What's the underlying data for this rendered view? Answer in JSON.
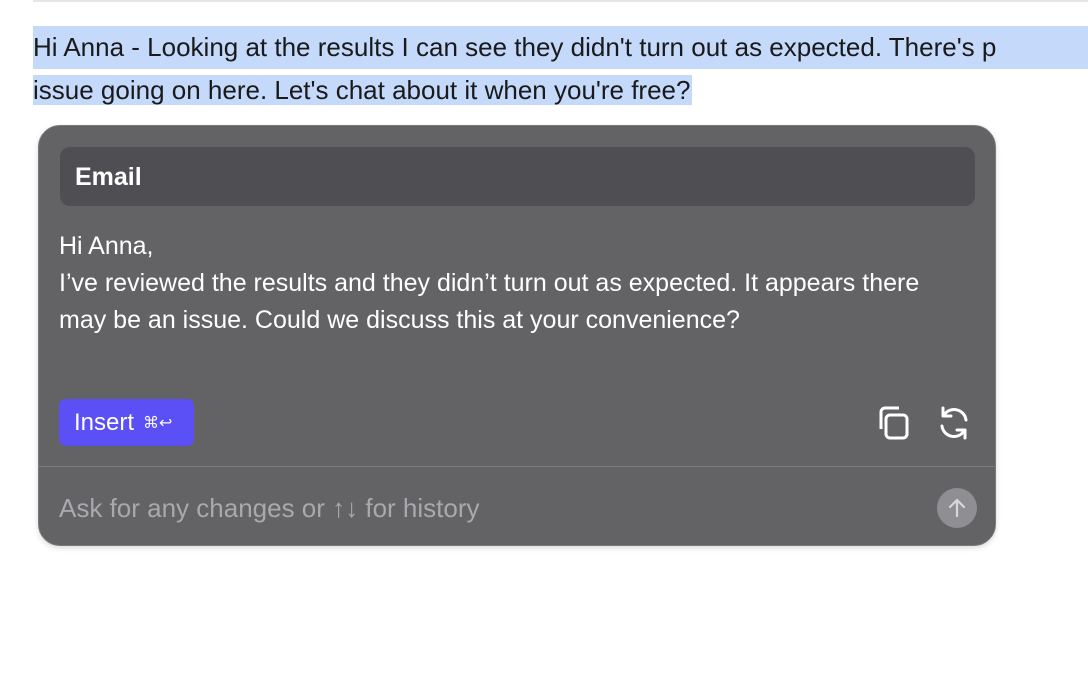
{
  "document": {
    "selected_line_1": "Hi Anna - Looking at the results I can see they didn't turn out as expected. There's p",
    "selected_line_2": "issue going on here. Let's chat about it when you're free?"
  },
  "assistant_panel": {
    "header_title": "Email",
    "draft": {
      "greeting": "Hi Anna,",
      "body": "I’ve reviewed the results and they didn’t turn out as expected. It appears there may be an issue. Could we discuss this at your convenience?"
    },
    "insert_button": {
      "label": "Insert",
      "shortcut": "⌘↩"
    },
    "icons": {
      "copy": "copy-icon",
      "regenerate": "refresh-icon",
      "send": "arrow-up-icon"
    },
    "prompt_input": {
      "value": "",
      "placeholder": "Ask for any changes or ↑↓ for history"
    }
  },
  "colors": {
    "selection": "#c5d9fb",
    "panel_bg": "#636366",
    "header_bg": "#4f4f53",
    "accent": "#5b50f5"
  }
}
